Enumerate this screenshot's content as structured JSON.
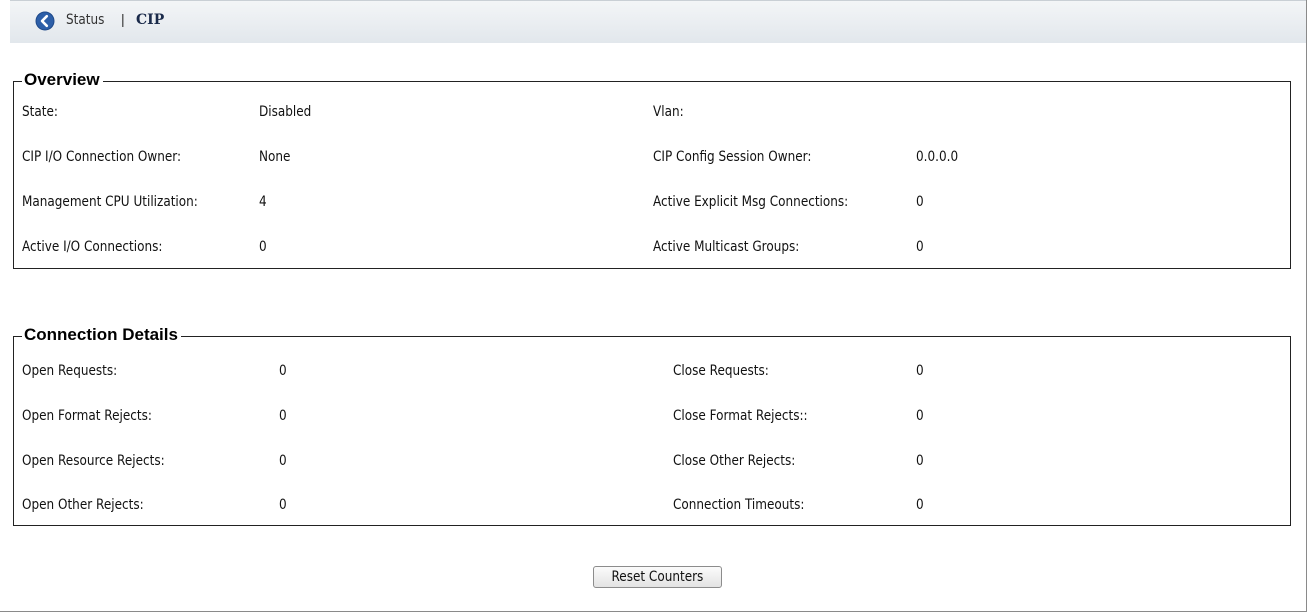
{
  "header": {
    "breadcrumb_parent": "Status",
    "separator": "|",
    "current_page": "CIP"
  },
  "overview": {
    "title": "Overview",
    "fields": {
      "state": {
        "label": "State:",
        "value": "Disabled"
      },
      "vlan": {
        "label": "Vlan:",
        "value": ""
      },
      "io_connection_owner": {
        "label": "CIP I/O Connection Owner:",
        "value": "None"
      },
      "config_session_owner": {
        "label": "CIP Config Session Owner:",
        "value": "0.0.0.0"
      },
      "mgmt_cpu": {
        "label": "Management CPU Utilization:",
        "value": "4"
      },
      "explicit_msg": {
        "label": "Active Explicit Msg Connections:",
        "value": "0"
      },
      "io_connections": {
        "label": "Active I/O Connections:",
        "value": "0"
      },
      "multicast_groups": {
        "label": "Active Multicast Groups:",
        "value": "0"
      }
    }
  },
  "connection_details": {
    "title": "Connection Details",
    "fields": {
      "open_requests": {
        "label": "Open Requests:",
        "value": "0"
      },
      "close_requests": {
        "label": "Close Requests:",
        "value": "0"
      },
      "open_format_rejects": {
        "label": "Open Format Rejects:",
        "value": "0"
      },
      "close_format_rejects": {
        "label": "Close Format Rejects::",
        "value": "0"
      },
      "open_resource_rejects": {
        "label": "Open Resource Rejects:",
        "value": "0"
      },
      "close_other_rejects": {
        "label": "Close Other Rejects:",
        "value": "0"
      },
      "open_other_rejects": {
        "label": "Open Other Rejects:",
        "value": "0"
      },
      "connection_timeouts": {
        "label": "Connection Timeouts:",
        "value": "0"
      }
    }
  },
  "actions": {
    "reset_label": "Reset Counters"
  },
  "colors": {
    "header_bg": "#e2e7ec",
    "back_icon": "#1f4a8a",
    "border": "#222222"
  },
  "icons": {
    "back": "back-arrow-circle-icon"
  }
}
